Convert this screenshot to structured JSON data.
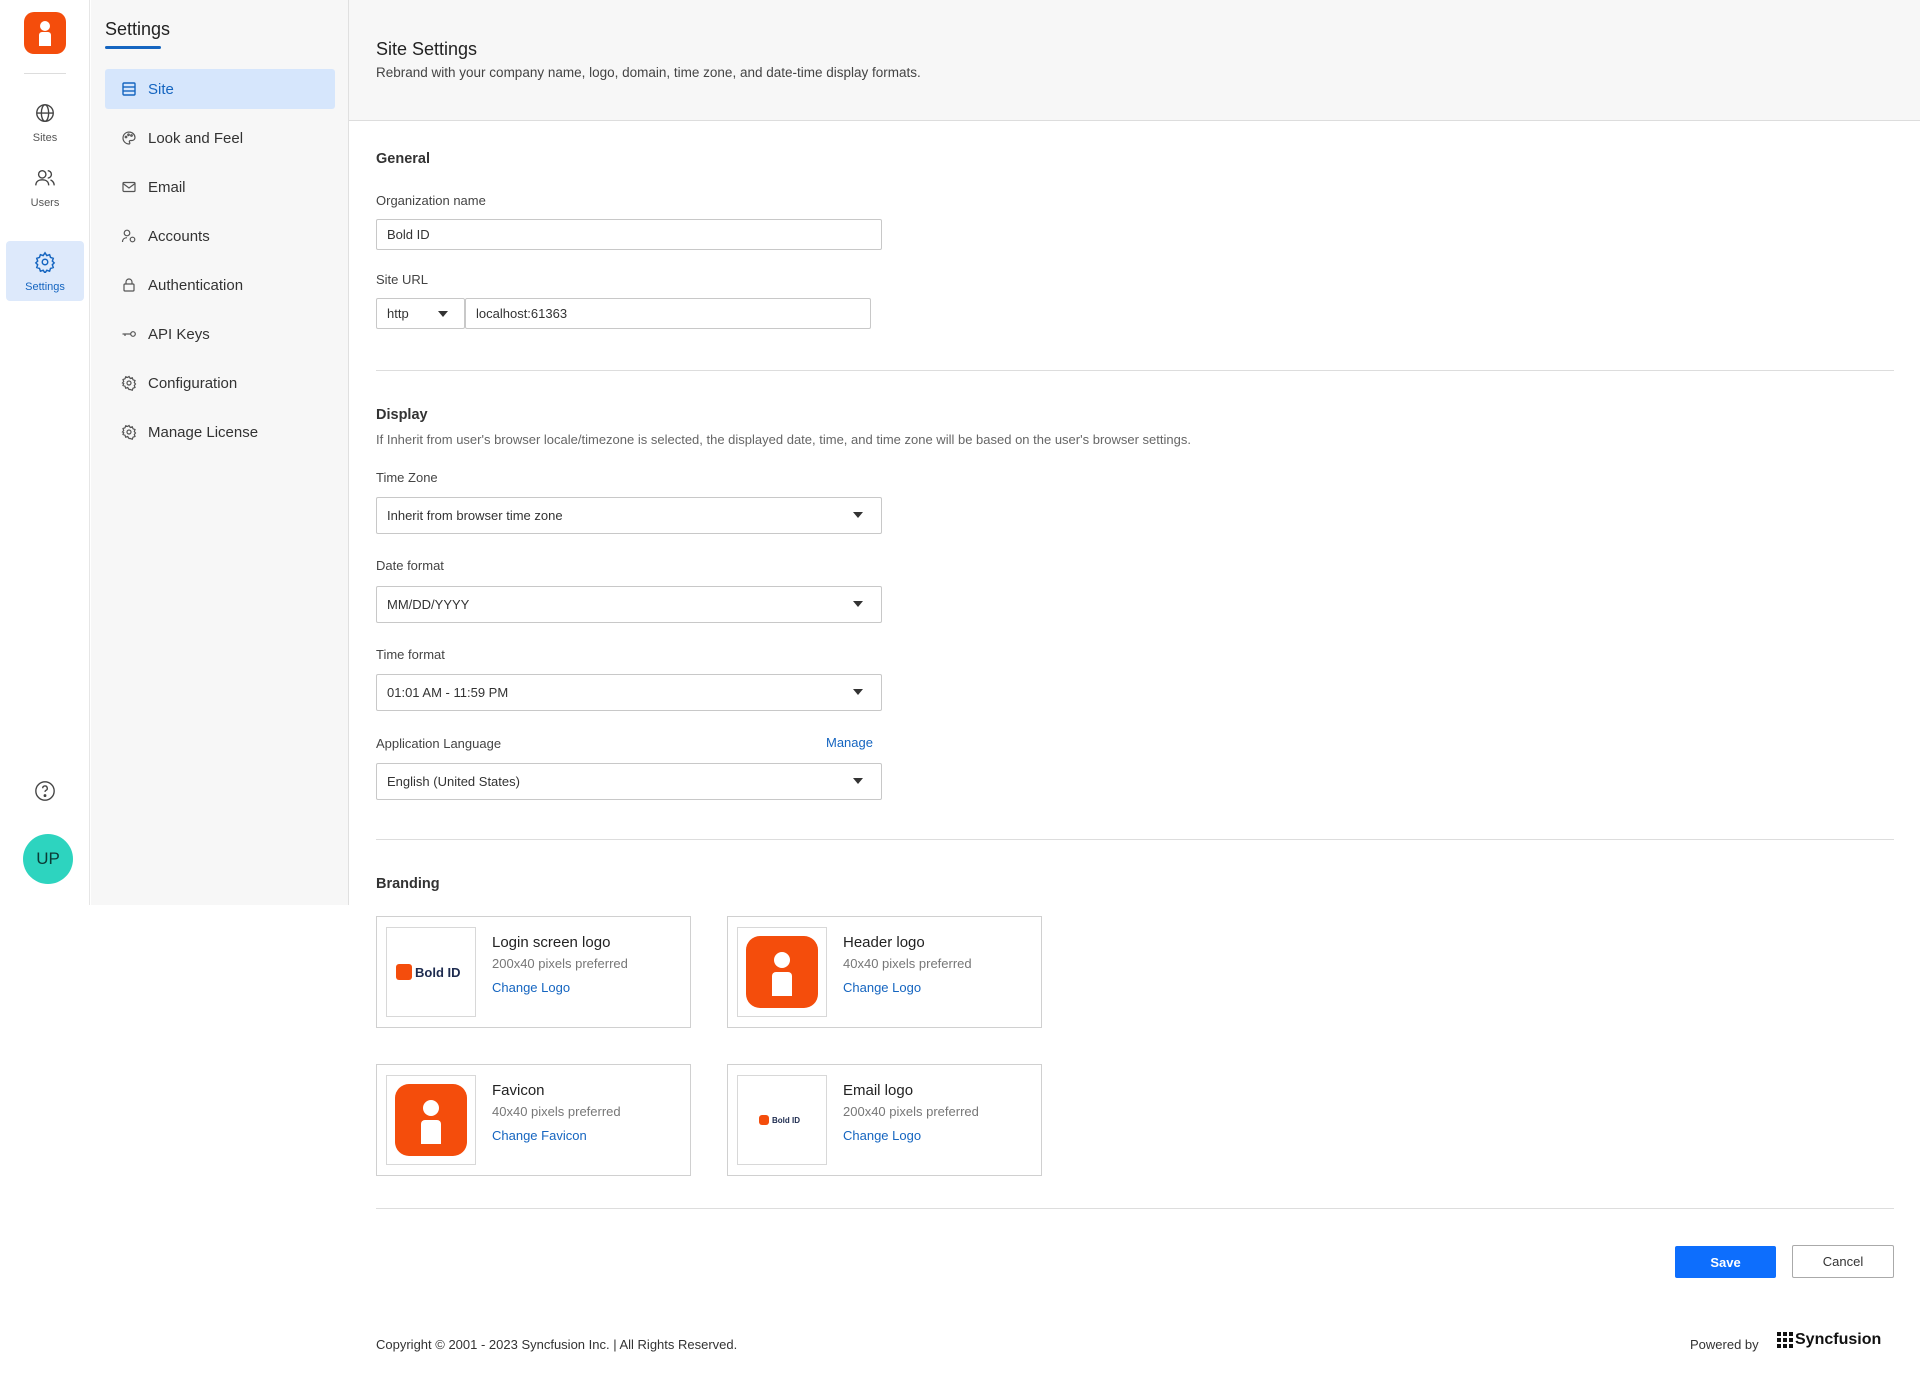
{
  "rail": {
    "items": [
      {
        "label": "Sites",
        "icon": "globe-icon"
      },
      {
        "label": "Users",
        "icon": "users-icon"
      },
      {
        "label": "Settings",
        "icon": "gear-icon"
      }
    ],
    "avatar_initials": "UP"
  },
  "nav": {
    "title": "Settings",
    "items": [
      {
        "label": "Site",
        "icon": "site-icon"
      },
      {
        "label": "Look and Feel",
        "icon": "palette-icon"
      },
      {
        "label": "Email",
        "icon": "mail-icon"
      },
      {
        "label": "Accounts",
        "icon": "account-icon"
      },
      {
        "label": "Authentication",
        "icon": "lock-icon"
      },
      {
        "label": "API Keys",
        "icon": "key-icon"
      },
      {
        "label": "Configuration",
        "icon": "gear-icon"
      },
      {
        "label": "Manage License",
        "icon": "license-icon"
      }
    ]
  },
  "page": {
    "title": "Site Settings",
    "subtitle": "Rebrand with your company name, logo, domain, time zone, and date-time display formats."
  },
  "general": {
    "title": "General",
    "org_label": "Organization name",
    "org_value": "Bold ID",
    "site_url_label": "Site URL",
    "protocol": "http",
    "host": "localhost:61363"
  },
  "display": {
    "title": "Display",
    "note": "If Inherit from user's browser locale/timezone is selected, the displayed date, time, and time zone will be based on the user's browser settings.",
    "timezone_label": "Time Zone",
    "timezone_value": "Inherit from browser time zone",
    "date_label": "Date format",
    "date_value": "MM/DD/YYYY",
    "time_label": "Time format",
    "time_value": "01:01 AM - 11:59 PM",
    "language_label": "Application Language",
    "language_manage": "Manage",
    "language_value": "English (United States)"
  },
  "branding": {
    "title": "Branding",
    "logo_text": "Bold ID",
    "cards": [
      {
        "name": "Login screen logo",
        "pref": "200x40 pixels preferred",
        "action": "Change Logo"
      },
      {
        "name": "Header logo",
        "pref": "40x40 pixels preferred",
        "action": "Change Logo"
      },
      {
        "name": "Favicon",
        "pref": "40x40 pixels preferred",
        "action": "Change Favicon"
      },
      {
        "name": "Email logo",
        "pref": "200x40 pixels preferred",
        "action": "Change Logo"
      }
    ]
  },
  "actions": {
    "save": "Save",
    "cancel": "Cancel"
  },
  "footer": {
    "copyright": "Copyright © 2001 - 2023 Syncfusion Inc. | All Rights Reserved.",
    "powered_by": "Powered by",
    "brand": "Syncfusion"
  },
  "colors": {
    "accent": "#1565c0",
    "brand": "#f44d0c",
    "primary_button": "#0d6efd",
    "avatar": "#2dd4bf"
  }
}
